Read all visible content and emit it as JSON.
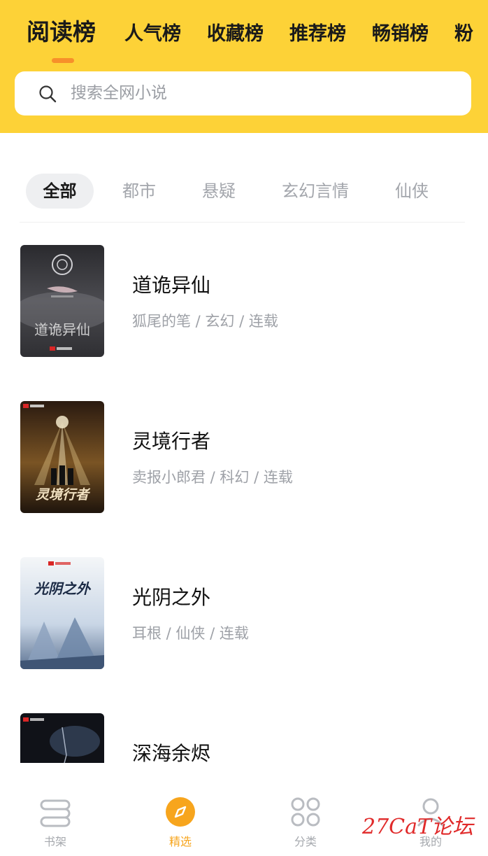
{
  "ranking_tabs": [
    {
      "label": "阅读榜",
      "active": true
    },
    {
      "label": "人气榜",
      "active": false
    },
    {
      "label": "收藏榜",
      "active": false
    },
    {
      "label": "推荐榜",
      "active": false
    },
    {
      "label": "畅销榜",
      "active": false
    },
    {
      "label": "粉",
      "active": false
    }
  ],
  "search": {
    "placeholder": "搜索全网小说"
  },
  "categories": [
    {
      "label": "全部",
      "active": true
    },
    {
      "label": "都市",
      "active": false
    },
    {
      "label": "悬疑",
      "active": false
    },
    {
      "label": "玄幻言情",
      "active": false
    },
    {
      "label": "仙侠",
      "active": false
    }
  ],
  "books": [
    {
      "title": "道诡异仙",
      "meta": "狐尾的笔 / 玄幻 / 连载",
      "cover_text": "道诡异仙"
    },
    {
      "title": "灵境行者",
      "meta": "卖报小郎君 / 科幻 / 连载",
      "cover_text": "灵境行者"
    },
    {
      "title": "光阴之外",
      "meta": "耳根 / 仙侠 / 连载",
      "cover_text": "光阴之外"
    },
    {
      "title": "深海余烬",
      "meta": "",
      "cover_text": ""
    }
  ],
  "tabbar": [
    {
      "label": "书架",
      "icon": "bookshelf-icon",
      "active": false
    },
    {
      "label": "精选",
      "icon": "compass-icon",
      "active": true
    },
    {
      "label": "分类",
      "icon": "category-grid-icon",
      "active": false
    },
    {
      "label": "我的",
      "icon": "profile-icon",
      "active": false
    }
  ],
  "watermark": {
    "text": "27CaT论坛"
  },
  "colors": {
    "header_bg": "#fdd237",
    "accent": "#f7902a",
    "active_tab": "#f7a51d"
  }
}
